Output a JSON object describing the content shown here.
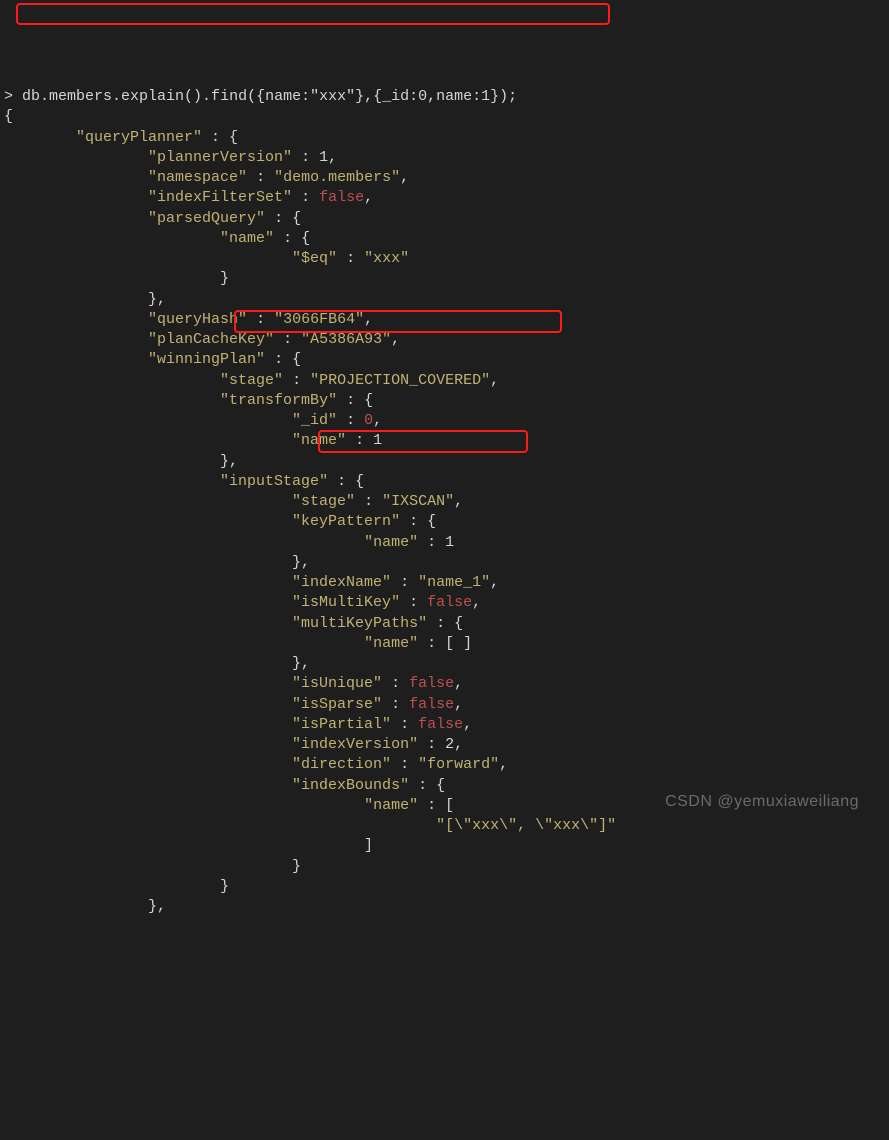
{
  "prompt": ">",
  "command": "db.members.explain().find({name:\"xxx\"},{_id:0,name:1});",
  "open_brace": "{",
  "qp": {
    "label": "\"queryPlanner\"",
    "plannerVersion_k": "\"plannerVersion\"",
    "plannerVersion_v": "1",
    "namespace_k": "\"namespace\"",
    "namespace_v": "\"demo.members\"",
    "indexFilterSet_k": "\"indexFilterSet\"",
    "indexFilterSet_v": "false",
    "parsedQuery_k": "\"parsedQuery\"",
    "pq_name_k": "\"name\"",
    "pq_eq_k": "\"$eq\"",
    "pq_eq_v": "\"xxx\"",
    "queryHash_k": "\"queryHash\"",
    "queryHash_v": "\"3066FB64\"",
    "planCacheKey_k": "\"planCacheKey\"",
    "planCacheKey_v": "\"A5386A93\"",
    "winningPlan_k": "\"winningPlan\"",
    "wp_stage_k": "\"stage\"",
    "wp_stage_v": "\"PROJECTION_COVERED\"",
    "transformBy_k": "\"transformBy\"",
    "tb_id_k": "\"_id\"",
    "tb_id_v": "0",
    "tb_name_k": "\"name\"",
    "tb_name_v": "1",
    "inputStage_k": "\"inputStage\"",
    "is_stage_k": "\"stage\"",
    "is_stage_v": "\"IXSCAN\"",
    "keyPattern_k": "\"keyPattern\"",
    "kp_name_k": "\"name\"",
    "kp_name_v": "1",
    "indexName_k": "\"indexName\"",
    "indexName_v": "\"name_1\"",
    "isMultiKey_k": "\"isMultiKey\"",
    "isMultiKey_v": "false",
    "multiKeyPaths_k": "\"multiKeyPaths\"",
    "mkp_name_k": "\"name\"",
    "mkp_name_v": "[ ]",
    "isUnique_k": "\"isUnique\"",
    "isUnique_v": "false",
    "isSparse_k": "\"isSparse\"",
    "isSparse_v": "false",
    "isPartial_k": "\"isPartial\"",
    "isPartial_v": "false",
    "indexVersion_k": "\"indexVersion\"",
    "indexVersion_v": "2",
    "direction_k": "\"direction\"",
    "direction_v": "\"forward\"",
    "indexBounds_k": "\"indexBounds\"",
    "ib_name_k": "\"name\"",
    "ib_name_v": "\"[\\\"xxx\\\", \\\"xxx\\\"]\""
  },
  "watermark": "CSDN @yemuxiaweiliang",
  "chart_data": {
    "type": "table",
    "title": "MongoDB explain() output for db.members find query",
    "command": "db.members.explain().find({name:\"xxx\"},{_id:0,name:1});",
    "queryPlanner": {
      "plannerVersion": 1,
      "namespace": "demo.members",
      "indexFilterSet": false,
      "parsedQuery": {
        "name": {
          "$eq": "xxx"
        }
      },
      "queryHash": "3066FB64",
      "planCacheKey": "A5386A93",
      "winningPlan": {
        "stage": "PROJECTION_COVERED",
        "transformBy": {
          "_id": 0,
          "name": 1
        },
        "inputStage": {
          "stage": "IXSCAN",
          "keyPattern": {
            "name": 1
          },
          "indexName": "name_1",
          "isMultiKey": false,
          "multiKeyPaths": {
            "name": []
          },
          "isUnique": false,
          "isSparse": false,
          "isPartial": false,
          "indexVersion": 2,
          "direction": "forward",
          "indexBounds": {
            "name": [
              "[\"xxx\", \"xxx\"]"
            ]
          }
        }
      }
    }
  }
}
